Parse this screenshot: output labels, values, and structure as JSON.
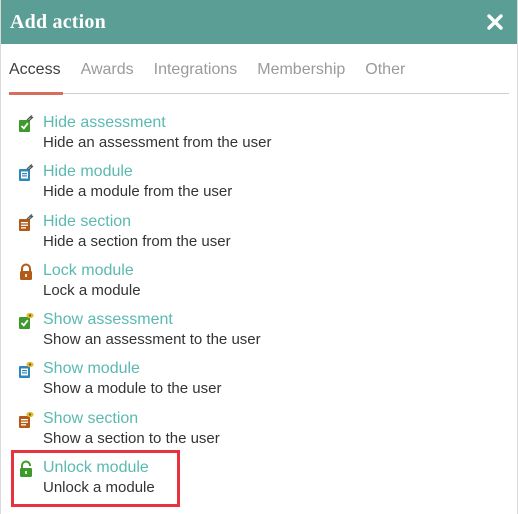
{
  "dialog": {
    "title": "Add action",
    "close_icon": "close-icon"
  },
  "tabs": [
    {
      "label": "Access",
      "active": true
    },
    {
      "label": "Awards",
      "active": false
    },
    {
      "label": "Integrations",
      "active": false
    },
    {
      "label": "Membership",
      "active": false
    },
    {
      "label": "Other",
      "active": false
    }
  ],
  "actions": [
    {
      "name": "Hide assessment",
      "desc": "Hide an assessment from the user",
      "icon": "hide-assessment-icon"
    },
    {
      "name": "Hide module",
      "desc": "Hide a module from the user",
      "icon": "hide-module-icon"
    },
    {
      "name": "Hide section",
      "desc": "Hide a section from the user",
      "icon": "hide-section-icon"
    },
    {
      "name": "Lock module",
      "desc": "Lock a module",
      "icon": "lock-icon"
    },
    {
      "name": "Show assessment",
      "desc": "Show an assessment to the user",
      "icon": "show-assessment-icon"
    },
    {
      "name": "Show module",
      "desc": "Show a module to the user",
      "icon": "show-module-icon"
    },
    {
      "name": "Show section",
      "desc": "Show a section to the user",
      "icon": "show-section-icon"
    },
    {
      "name": "Unlock module",
      "desc": "Unlock a module",
      "icon": "unlock-icon"
    }
  ],
  "colors": {
    "header": "#5a9e96",
    "action_link": "#5ab9b0",
    "active_tab_underline": "#d76d5c",
    "highlight": "#e8333f"
  }
}
